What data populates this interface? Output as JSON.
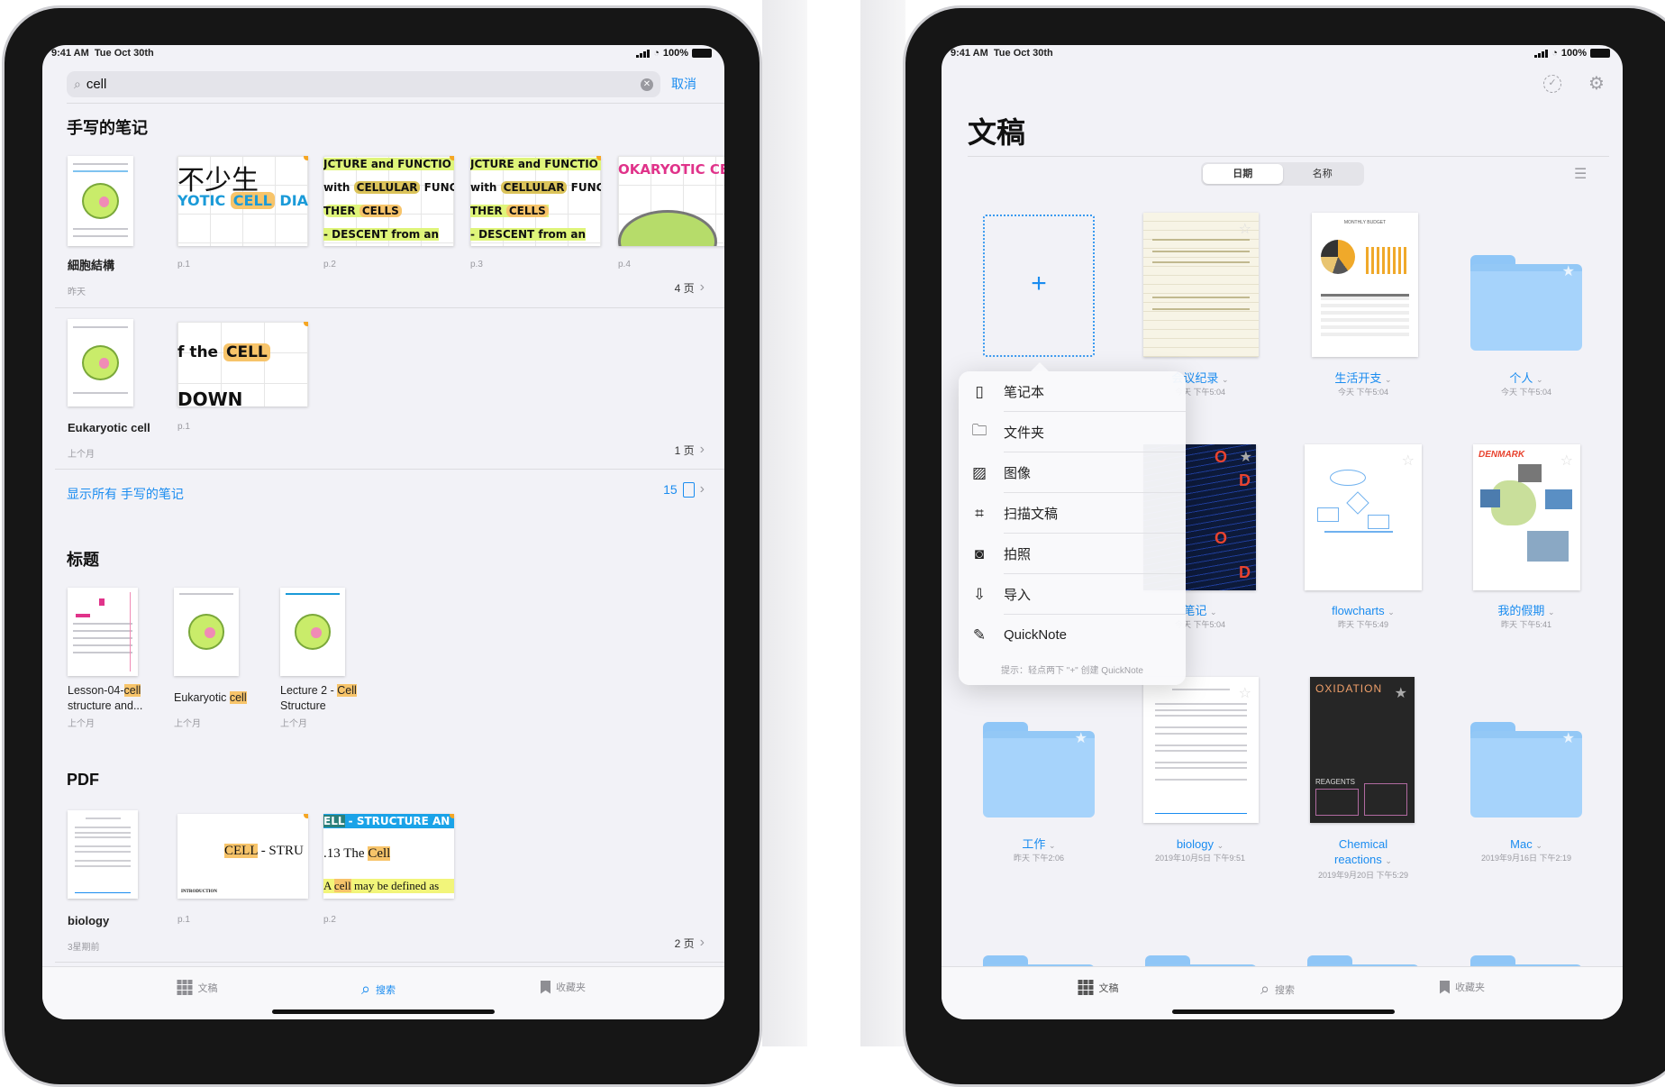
{
  "status_bar": {
    "time": "9:41 AM",
    "date": "Tue Oct 30th",
    "battery": "100%"
  },
  "colors": {
    "accent": "#1a8cf0",
    "highlight": "#f7c46a",
    "folder": "#a6d3fb",
    "background": "#f2f2f7"
  },
  "search_screen": {
    "search": {
      "value": "cell",
      "cancel_label": "取消",
      "icon": "magnifier-icon"
    },
    "handwritten": {
      "heading": "手写的笔记",
      "results": [
        {
          "title": "細胞結構",
          "date": "昨天",
          "page_count": "4 页",
          "pages": [
            "p.1",
            "p.2",
            "p.3",
            "p.4"
          ]
        },
        {
          "title": "Eukaryotic cell",
          "date": "上个月",
          "page_count": "1 页",
          "pages": [
            "p.1"
          ]
        }
      ],
      "snippets": {
        "p1_line1": "不少生",
        "p1_line2a": "YOTIC ",
        "p1_line2b": "CELL",
        "p1_line2c": " DIAG",
        "p2_line1": "JCTURE and FUNCTIO",
        "p2_line2a": "with ",
        "p2_line2b": "CELLULAR",
        "p2_line2c": " FUNC",
        "p2_line3a": "THER ",
        "p2_line3b": "CELLS",
        "p2_line4": "- DESCENT from an",
        "p4_line1": "OKARYOTIC CELL",
        "e1_line1a": "f the ",
        "e1_line1b": "CELL",
        "e1_line2": "DOWN"
      },
      "show_all_label": "显示所有 手写的笔记",
      "show_all_count": "15"
    },
    "titles": {
      "heading": "标题",
      "items": [
        {
          "line1_pre": "Lesson-04-",
          "line1_hl": "cell",
          "line2": "structure and...",
          "date": "上个月"
        },
        {
          "line1_pre": "Eukaryotic ",
          "line1_hl": "cell",
          "line2": "",
          "date": "上个月"
        },
        {
          "line1_pre": "Lecture 2 - ",
          "line1_hl": "Cell",
          "line2": "Structure",
          "date": "上个月"
        }
      ]
    },
    "pdf": {
      "heading": "PDF",
      "result": {
        "title": "biology",
        "date": "3星期前",
        "page_count": "2 页",
        "pages": [
          "p.1",
          "p.2"
        ]
      },
      "snippets": {
        "p1_hl": "CELL",
        "p1_rest": " - STRU",
        "p1_footer": "INTRODUCTION",
        "p2_banner_hl": "ELL",
        "p2_banner_rest": " - STRUCTURE AN",
        "p2_line1": ".13 The ",
        "p2_line1_hl": "Cell",
        "p2_line2_pre": "A ",
        "p2_line2_hl": "cell",
        "p2_line2_rest": " may be defined as"
      }
    },
    "tabbar": [
      {
        "label": "文稿",
        "icon": "grid-icon",
        "active": false
      },
      {
        "label": "搜索",
        "icon": "search-icon",
        "active": true
      },
      {
        "label": "收藏夹",
        "icon": "bookmark-icon",
        "active": false
      }
    ]
  },
  "documents_screen": {
    "title": "文稿",
    "toolbar": {
      "select_icon": "checkmark-circle-icon",
      "settings_icon": "gear-icon",
      "view_icon": "list-icon"
    },
    "sort": {
      "options": [
        "日期",
        "名称"
      ],
      "selected": "日期"
    },
    "items": [
      {
        "name": "会议纪录",
        "time": "今天 下午5:04",
        "type": "notebook"
      },
      {
        "name": "生活开支",
        "time": "今天 下午5:04",
        "type": "notebook"
      },
      {
        "name": "个人",
        "time": "今天 下午5:04",
        "type": "folder"
      },
      {
        "name": "笔记",
        "time": "今天 下午5:04",
        "type": "notebook"
      },
      {
        "name": "flowcharts",
        "time": "昨天 下午5:49",
        "type": "notebook"
      },
      {
        "name": "我的假期",
        "time": "昨天 下午5:41",
        "type": "notebook"
      },
      {
        "name": "工作",
        "time": "昨天 下午2:06",
        "type": "folder"
      },
      {
        "name": "biology",
        "time": "2019年10月5日 下午9:51",
        "type": "pdf"
      },
      {
        "name_line1": "Chemical",
        "name_line2": "reactions",
        "time": "2019年9月20日 下午5:29",
        "type": "notebook"
      },
      {
        "name": "Mac",
        "time": "2019年9月16日 下午2:19",
        "type": "folder"
      }
    ],
    "cover_text": {
      "oxidation": "OXIDATION",
      "reagents": "REAGENTS",
      "budget": "MONTHLY BUDGET",
      "vacation": "DENMARK"
    },
    "new_menu": {
      "items": [
        {
          "label": "笔记本",
          "icon": "notebook-icon"
        },
        {
          "label": "文件夹",
          "icon": "folder-icon"
        },
        {
          "label": "图像",
          "icon": "image-icon"
        },
        {
          "label": "扫描文稿",
          "icon": "scan-icon"
        },
        {
          "label": "拍照",
          "icon": "camera-icon"
        },
        {
          "label": "导入",
          "icon": "import-icon"
        },
        {
          "label": "QuickNote",
          "icon": "quicknote-icon"
        }
      ],
      "hint": "提示：轻点两下 \"+\" 创建 QuickNote"
    },
    "tabbar": [
      {
        "label": "文稿",
        "icon": "grid-icon",
        "active": true
      },
      {
        "label": "搜索",
        "icon": "search-icon",
        "active": false
      },
      {
        "label": "收藏夹",
        "icon": "bookmark-icon",
        "active": false
      }
    ]
  }
}
